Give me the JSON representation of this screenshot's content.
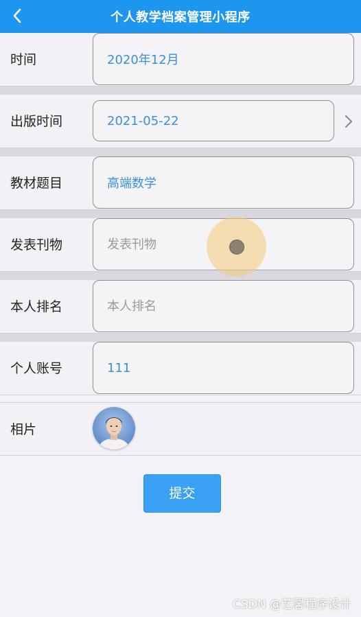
{
  "navbar": {
    "title": "个人教学档案管理小程序"
  },
  "form": {
    "time": {
      "label": "时间",
      "value": "2020年12月"
    },
    "publish_time": {
      "label": "出版时间",
      "value": "2021-05-22"
    },
    "textbook_title": {
      "label": "教材题目",
      "value": "高端数学"
    },
    "journal": {
      "label": "发表刊物",
      "value": "",
      "placeholder": "发表刊物"
    },
    "rank": {
      "label": "本人排名",
      "value": "",
      "placeholder": "本人排名"
    },
    "account": {
      "label": "个人账号",
      "value": "111"
    },
    "photo": {
      "label": "相片"
    }
  },
  "submit_label": "提交",
  "watermark": "CSDN @艺馨程序设计",
  "colors": {
    "navbar": "#1d96f0",
    "value_text": "#3b8fd8",
    "submit": "#3aa2f4"
  },
  "icons": {
    "back": "chevron-left-icon",
    "date_picker": "chevron-right-icon"
  }
}
